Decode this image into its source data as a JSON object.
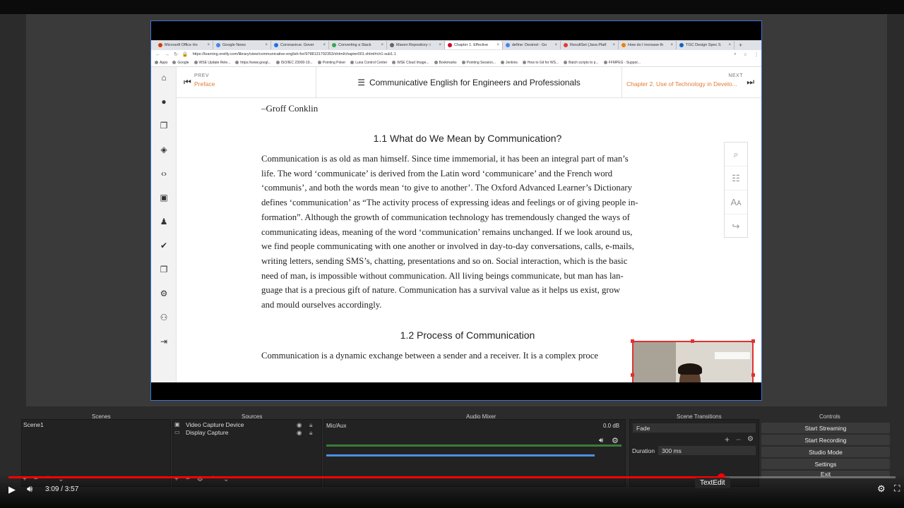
{
  "browser": {
    "tabs": [
      {
        "title": "Microsoft Office Ho",
        "color": "#d83b01"
      },
      {
        "title": "Google News",
        "color": "#4285f4"
      },
      {
        "title": "Coronavirus: Gover",
        "color": "#1a73e8"
      },
      {
        "title": "Converting a Stack",
        "color": "#34a853"
      },
      {
        "title": "Maven Repository: i",
        "color": "#666666"
      },
      {
        "title": "Chapter 1. Effective",
        "color": "#d3002d"
      },
      {
        "title": "define: Desired - Go",
        "color": "#4285f4"
      },
      {
        "title": "ResultSet (Java Platf",
        "color": "#e53935"
      },
      {
        "title": "How do I increase th",
        "color": "#f57c00"
      },
      {
        "title": "TGC Design Spec S",
        "color": "#1565c0"
      }
    ],
    "url": "https://learning.oreilly.com/library/view/communicative-english-for/9788131792353/xhtml/chapter001.xhtml#ch1-sub1.1",
    "bookmarks": [
      "Apps",
      "Google",
      "WSE Update Rele...",
      "https://www.googl...",
      "ISO/IEC 23000-19...",
      "Pointing Poker",
      "Luna Control Center",
      "WSE Cloud Image...",
      "Bookmarks",
      "Pointing Session...",
      "Jenkins",
      "How to Git for WS...",
      "Batch scripts to p...",
      "FFMPEG - Suppor..."
    ]
  },
  "book": {
    "prev_label": "PREV",
    "prev_title": "Preface",
    "title": "Communicative English for Engineers and Professionals",
    "next_label": "NEXT",
    "next_title": "Chapter 2. Use of Technology in Develo...",
    "author": "–Groff Conklin",
    "heading1": "1.1 What do We Mean by Communication?",
    "para1": [
      "Communication is as old as man himself. Since time immemorial, it has been an integral part of man’s",
      "life. The word ‘communicate’ is derived from the Latin word ‘communicare’ and the French word",
      "‘communis’, and both the words mean ‘to give to another’. The Oxford Advanced Learner’s Dictionary",
      "defines ‘communication’ as “The activity process of expressing ideas and feelings or of giving people in-",
      "formation”. Although the growth of communication technology has tremendously changed the ways of",
      "communicating ideas, meaning of the word ‘communication’ remains unchanged. If we look around us,",
      "we find people communicating with one another or involved in day-to-day conversations, calls, e-mails,",
      "writing letters, sending SMS’s, chatting, presentations and so on. Social interaction, which is the basic",
      "need of man, is impossible without communication. All living beings communicate, but man has lan-",
      "guage that is a precious gift of nature. Communication has a survival value as it helps us exist, grow",
      "and mould ourselves accordingly."
    ],
    "heading2": "1.2 Process of Communication",
    "para2_line": "Communication is a dynamic exchange between a sender and a receiver. It is a complex proce"
  },
  "obs": {
    "scenes_header": "Scenes",
    "sources_header": "Sources",
    "mixer_header": "Audio Mixer",
    "transitions_header": "Scene Transitions",
    "controls_header": "Controls",
    "scene": "Scene1",
    "sources": [
      "Video Capture Device",
      "Display Capture"
    ],
    "mixer_channel": "Mic/Aux",
    "mixer_db": "0.0 dB",
    "transition": "Fade",
    "duration_label": "Duration",
    "duration_value": "300 ms",
    "buttons": [
      "Start Streaming",
      "Start Recording",
      "Studio Mode",
      "Settings",
      "Exit"
    ]
  },
  "player": {
    "time": "3:09 / 3:57",
    "progress": 0.803,
    "tooltip": "TextEdit"
  }
}
